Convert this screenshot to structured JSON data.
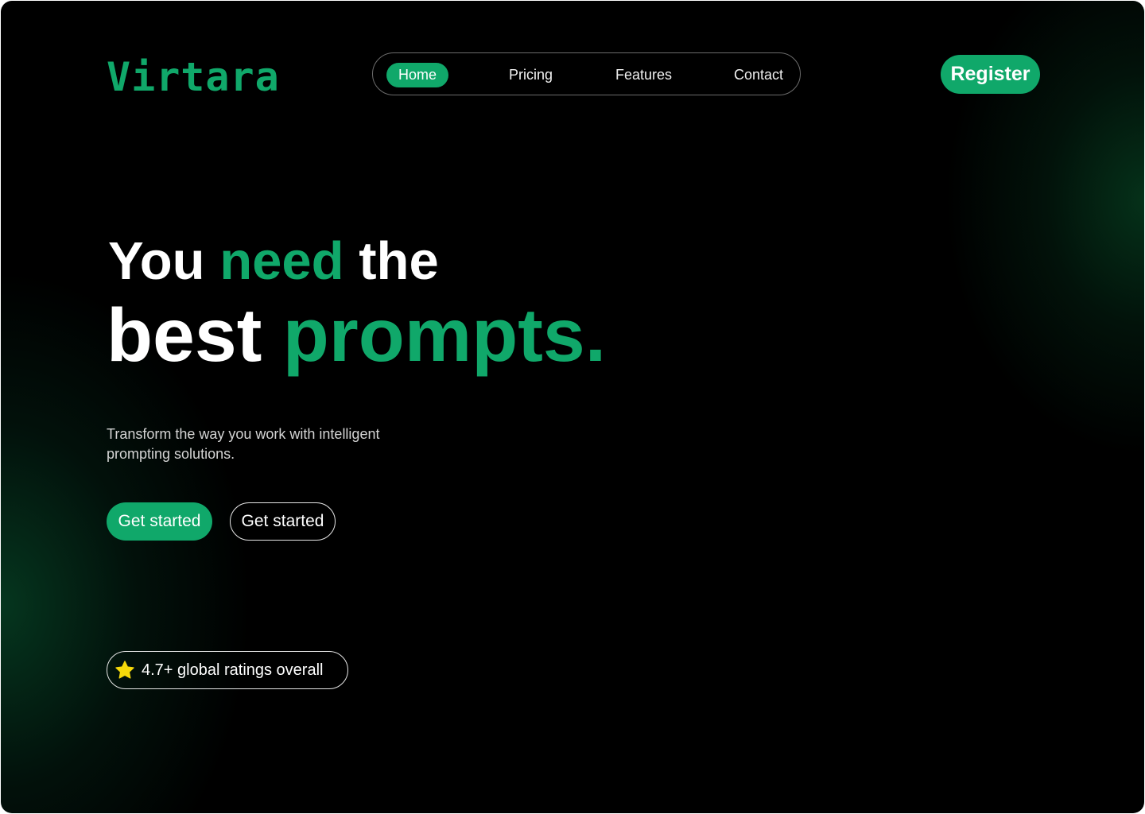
{
  "brand": {
    "name": "Virtara",
    "accent_color": "#10a86a",
    "background_color": "#000000"
  },
  "nav": {
    "items": [
      {
        "label": "Home",
        "active": true
      },
      {
        "label": "Pricing",
        "active": false
      },
      {
        "label": "Features",
        "active": false
      },
      {
        "label": "Contact",
        "active": false
      }
    ]
  },
  "header": {
    "register_label": "Register"
  },
  "hero": {
    "line1_word1": "You",
    "line1_word2": "need",
    "line1_word3": "the",
    "line2_word1": "best",
    "line2_word2": "prompts.",
    "subtitle": "Transform the way you work with intelligent prompting solutions."
  },
  "cta": {
    "primary_label": "Get started",
    "secondary_label": "Get started"
  },
  "rating": {
    "icon": "star-icon",
    "star_color": "#f5d90a",
    "text": "4.7+ global ratings overall"
  }
}
